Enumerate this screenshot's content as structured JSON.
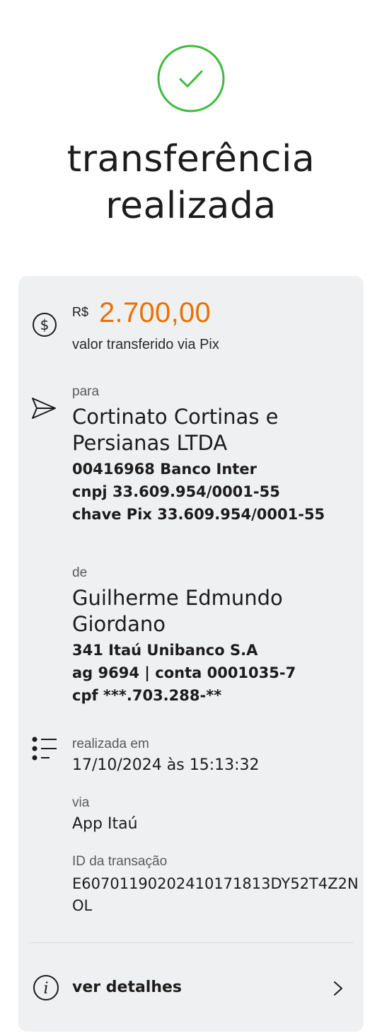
{
  "header": {
    "title_line1": "transferência",
    "title_line2": "realizada",
    "status_icon": "check-circle-icon",
    "success_color": "#3dbb3d"
  },
  "amount": {
    "currency": "R$",
    "value": "2.700,00",
    "caption": "valor transferido via Pix",
    "accent_color": "#ec7000"
  },
  "recipient": {
    "label": "para",
    "name_line1": "Cortinato Cortinas e",
    "name_line2": "Persianas LTDA",
    "bank": "00416968 Banco Inter",
    "cnpj": "cnpj 33.609.954/0001-55",
    "pix_key": "chave Pix 33.609.954/0001-55"
  },
  "sender": {
    "label": "de",
    "name_line1": "Guilherme Edmundo",
    "name_line2": "Giordano",
    "bank": "341 Itaú Unibanco S.A",
    "account": "ag 9694 | conta 0001035-7",
    "cpf": "cpf ***.703.288-**"
  },
  "info": {
    "date_label": "realizada em",
    "date_value": "17/10/2024 às 15:13:32",
    "via_label": "via",
    "via_value": "App Itaú",
    "id_label": "ID da transação",
    "id_line1": "E60701190202410171813DY52T4Z2N",
    "id_line2": "OL"
  },
  "footer": {
    "details_label": "ver detalhes"
  }
}
